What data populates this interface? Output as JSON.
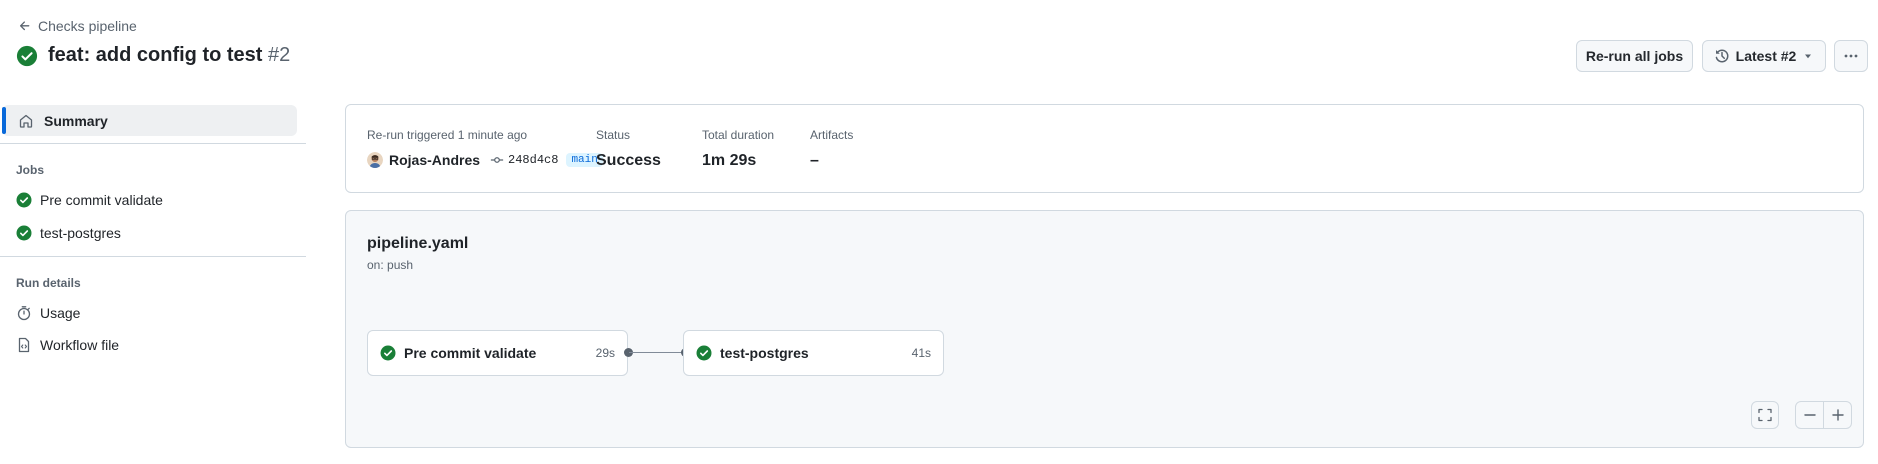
{
  "header": {
    "back_label": "Checks pipeline",
    "title": "feat: add config to test",
    "run_number": "#2",
    "rerun_label": "Re-run all jobs",
    "latest_label": "Latest #2"
  },
  "sidebar": {
    "summary_label": "Summary",
    "jobs_heading": "Jobs",
    "jobs": [
      {
        "label": "Pre commit validate",
        "status": "success"
      },
      {
        "label": "test-postgres",
        "status": "success"
      }
    ],
    "run_details_heading": "Run details",
    "run_details": [
      {
        "label": "Usage",
        "icon": "stopwatch-icon"
      },
      {
        "label": "Workflow file",
        "icon": "file-code-icon"
      }
    ]
  },
  "summary": {
    "trigger_label": "Re-run triggered 1 minute ago",
    "actor": "Rojas-Andres",
    "commit": "248d4c8",
    "branch": "main",
    "status_label": "Status",
    "status_value": "Success",
    "duration_label": "Total duration",
    "duration_value": "1m 29s",
    "artifacts_label": "Artifacts",
    "artifacts_value": "–"
  },
  "workflow": {
    "file": "pipeline.yaml",
    "trigger": "on: push",
    "jobs": [
      {
        "name": "Pre commit validate",
        "duration": "29s",
        "status": "success"
      },
      {
        "name": "test-postgres",
        "duration": "41s",
        "status": "success"
      }
    ]
  },
  "colors": {
    "success": "#1a7f37",
    "accent": "#0969da",
    "border": "#d1d9e0"
  }
}
